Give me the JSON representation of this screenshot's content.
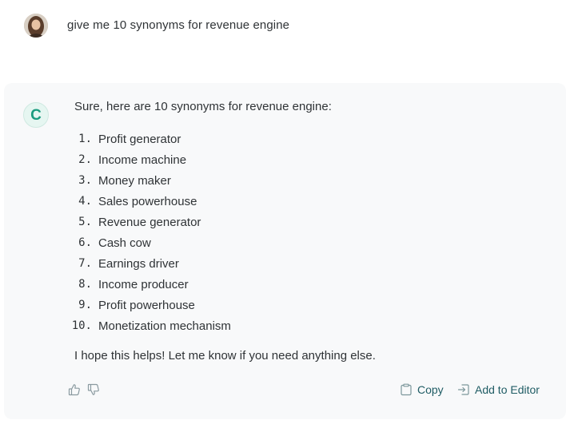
{
  "user_message": {
    "text": "give me 10 synonyms for revenue engine"
  },
  "assistant": {
    "logo_letter": "C",
    "intro": "Sure, here are 10 synonyms for revenue engine:",
    "items": [
      {
        "num": "1.",
        "text": "Profit generator"
      },
      {
        "num": "2.",
        "text": "Income machine"
      },
      {
        "num": "3.",
        "text": "Money maker"
      },
      {
        "num": "4.",
        "text": "Sales powerhouse"
      },
      {
        "num": "5.",
        "text": "Revenue generator"
      },
      {
        "num": "6.",
        "text": "Cash cow"
      },
      {
        "num": "7.",
        "text": "Earnings driver"
      },
      {
        "num": "8.",
        "text": "Income producer"
      },
      {
        "num": "9.",
        "text": "Profit powerhouse"
      },
      {
        "num": "10.",
        "text": "Monetization mechanism"
      }
    ],
    "outro": "I hope this helps! Let me know if you need anything else."
  },
  "actions": {
    "copy_label": "Copy",
    "add_to_editor_label": "Add to Editor",
    "thumb_up_icon": "thumbs-up-icon",
    "thumb_down_icon": "thumbs-down-icon",
    "copy_icon": "clipboard-icon",
    "editor_icon": "add-to-editor-icon"
  },
  "colors": {
    "accent": "#1a9b7f",
    "action_text": "#1f5c64",
    "card_bg": "#f8f9fa"
  }
}
